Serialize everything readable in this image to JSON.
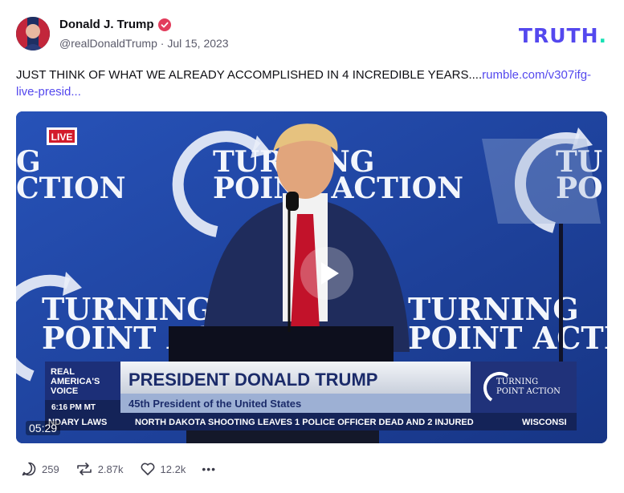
{
  "post": {
    "author_name": "Donald J. Trump",
    "handle": "@realDonaldTrump",
    "separator": "·",
    "date": "Jul 15, 2023",
    "text": "JUST THINK OF WHAT WE ALREADY ACCOMPLISHED IN 4 INCREDIBLE YEARS....",
    "link_text": "rumble.com/v307ifg-live-presid..."
  },
  "brand": {
    "word": "TRUTH",
    "dot": "."
  },
  "video": {
    "live_badge": "LIVE",
    "backdrop_text_1": "TURNING",
    "backdrop_text_2": "POINT ACTION",
    "backdrop_left_1": "G",
    "backdrop_left_2": "CTION",
    "backdrop_right_1": "TU",
    "backdrop_right_2": "PO",
    "chyron_title": "PRESIDENT DONALD TRUMP",
    "chyron_subtitle": "45th President of the United States",
    "network_name_1": "REAL",
    "network_name_2": "AMERICA'S",
    "network_name_3": "VOICE",
    "network_time": "6:16 PM MT",
    "logo_line_1": "TURNING",
    "logo_line_2": "POINT ACTION",
    "ticker_1": "NDARY LAWS",
    "ticker_2": "NORTH DAKOTA SHOOTING LEAVES 1 POLICE OFFICER DEAD AND 2 INJURED",
    "ticker_3": "WISCONSI",
    "duration": "05:29"
  },
  "actions": {
    "replies": "259",
    "retruths": "2.87k",
    "likes": "12.2k",
    "more": "•••"
  },
  "colors": {
    "brand_purple": "#5448ee",
    "brand_green": "#17e1b4",
    "verified_red": "#e23c5c",
    "stage_blue": "#1e3f99"
  }
}
